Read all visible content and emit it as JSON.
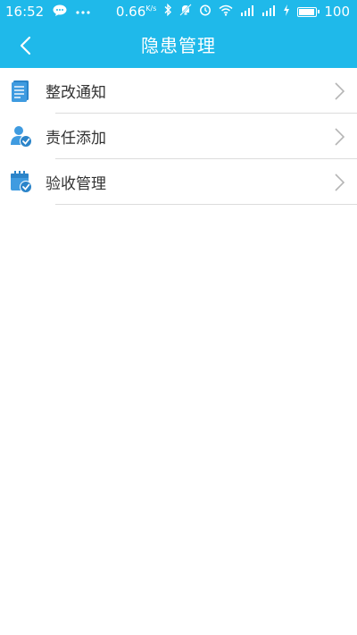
{
  "status_bar": {
    "time": "16:52",
    "notification_icons": [
      "chat-bubble-icon",
      "more-dots-icon"
    ],
    "net_speed": "0.66",
    "net_speed_unit": "K/s",
    "right_icons": [
      "bluetooth-icon",
      "mute-icon",
      "alarm-icon",
      "wifi-icon",
      "signal-icon",
      "signal-icon",
      "charging-icon"
    ],
    "battery_level": 100,
    "battery_text": "100"
  },
  "header": {
    "title": "隐患管理",
    "background_color": "#1fb9ea"
  },
  "menu": {
    "items": [
      {
        "label": "整改通知",
        "icon": "document-icon"
      },
      {
        "label": "责任添加",
        "icon": "user-check-icon"
      },
      {
        "label": "验收管理",
        "icon": "calendar-check-icon"
      }
    ]
  }
}
